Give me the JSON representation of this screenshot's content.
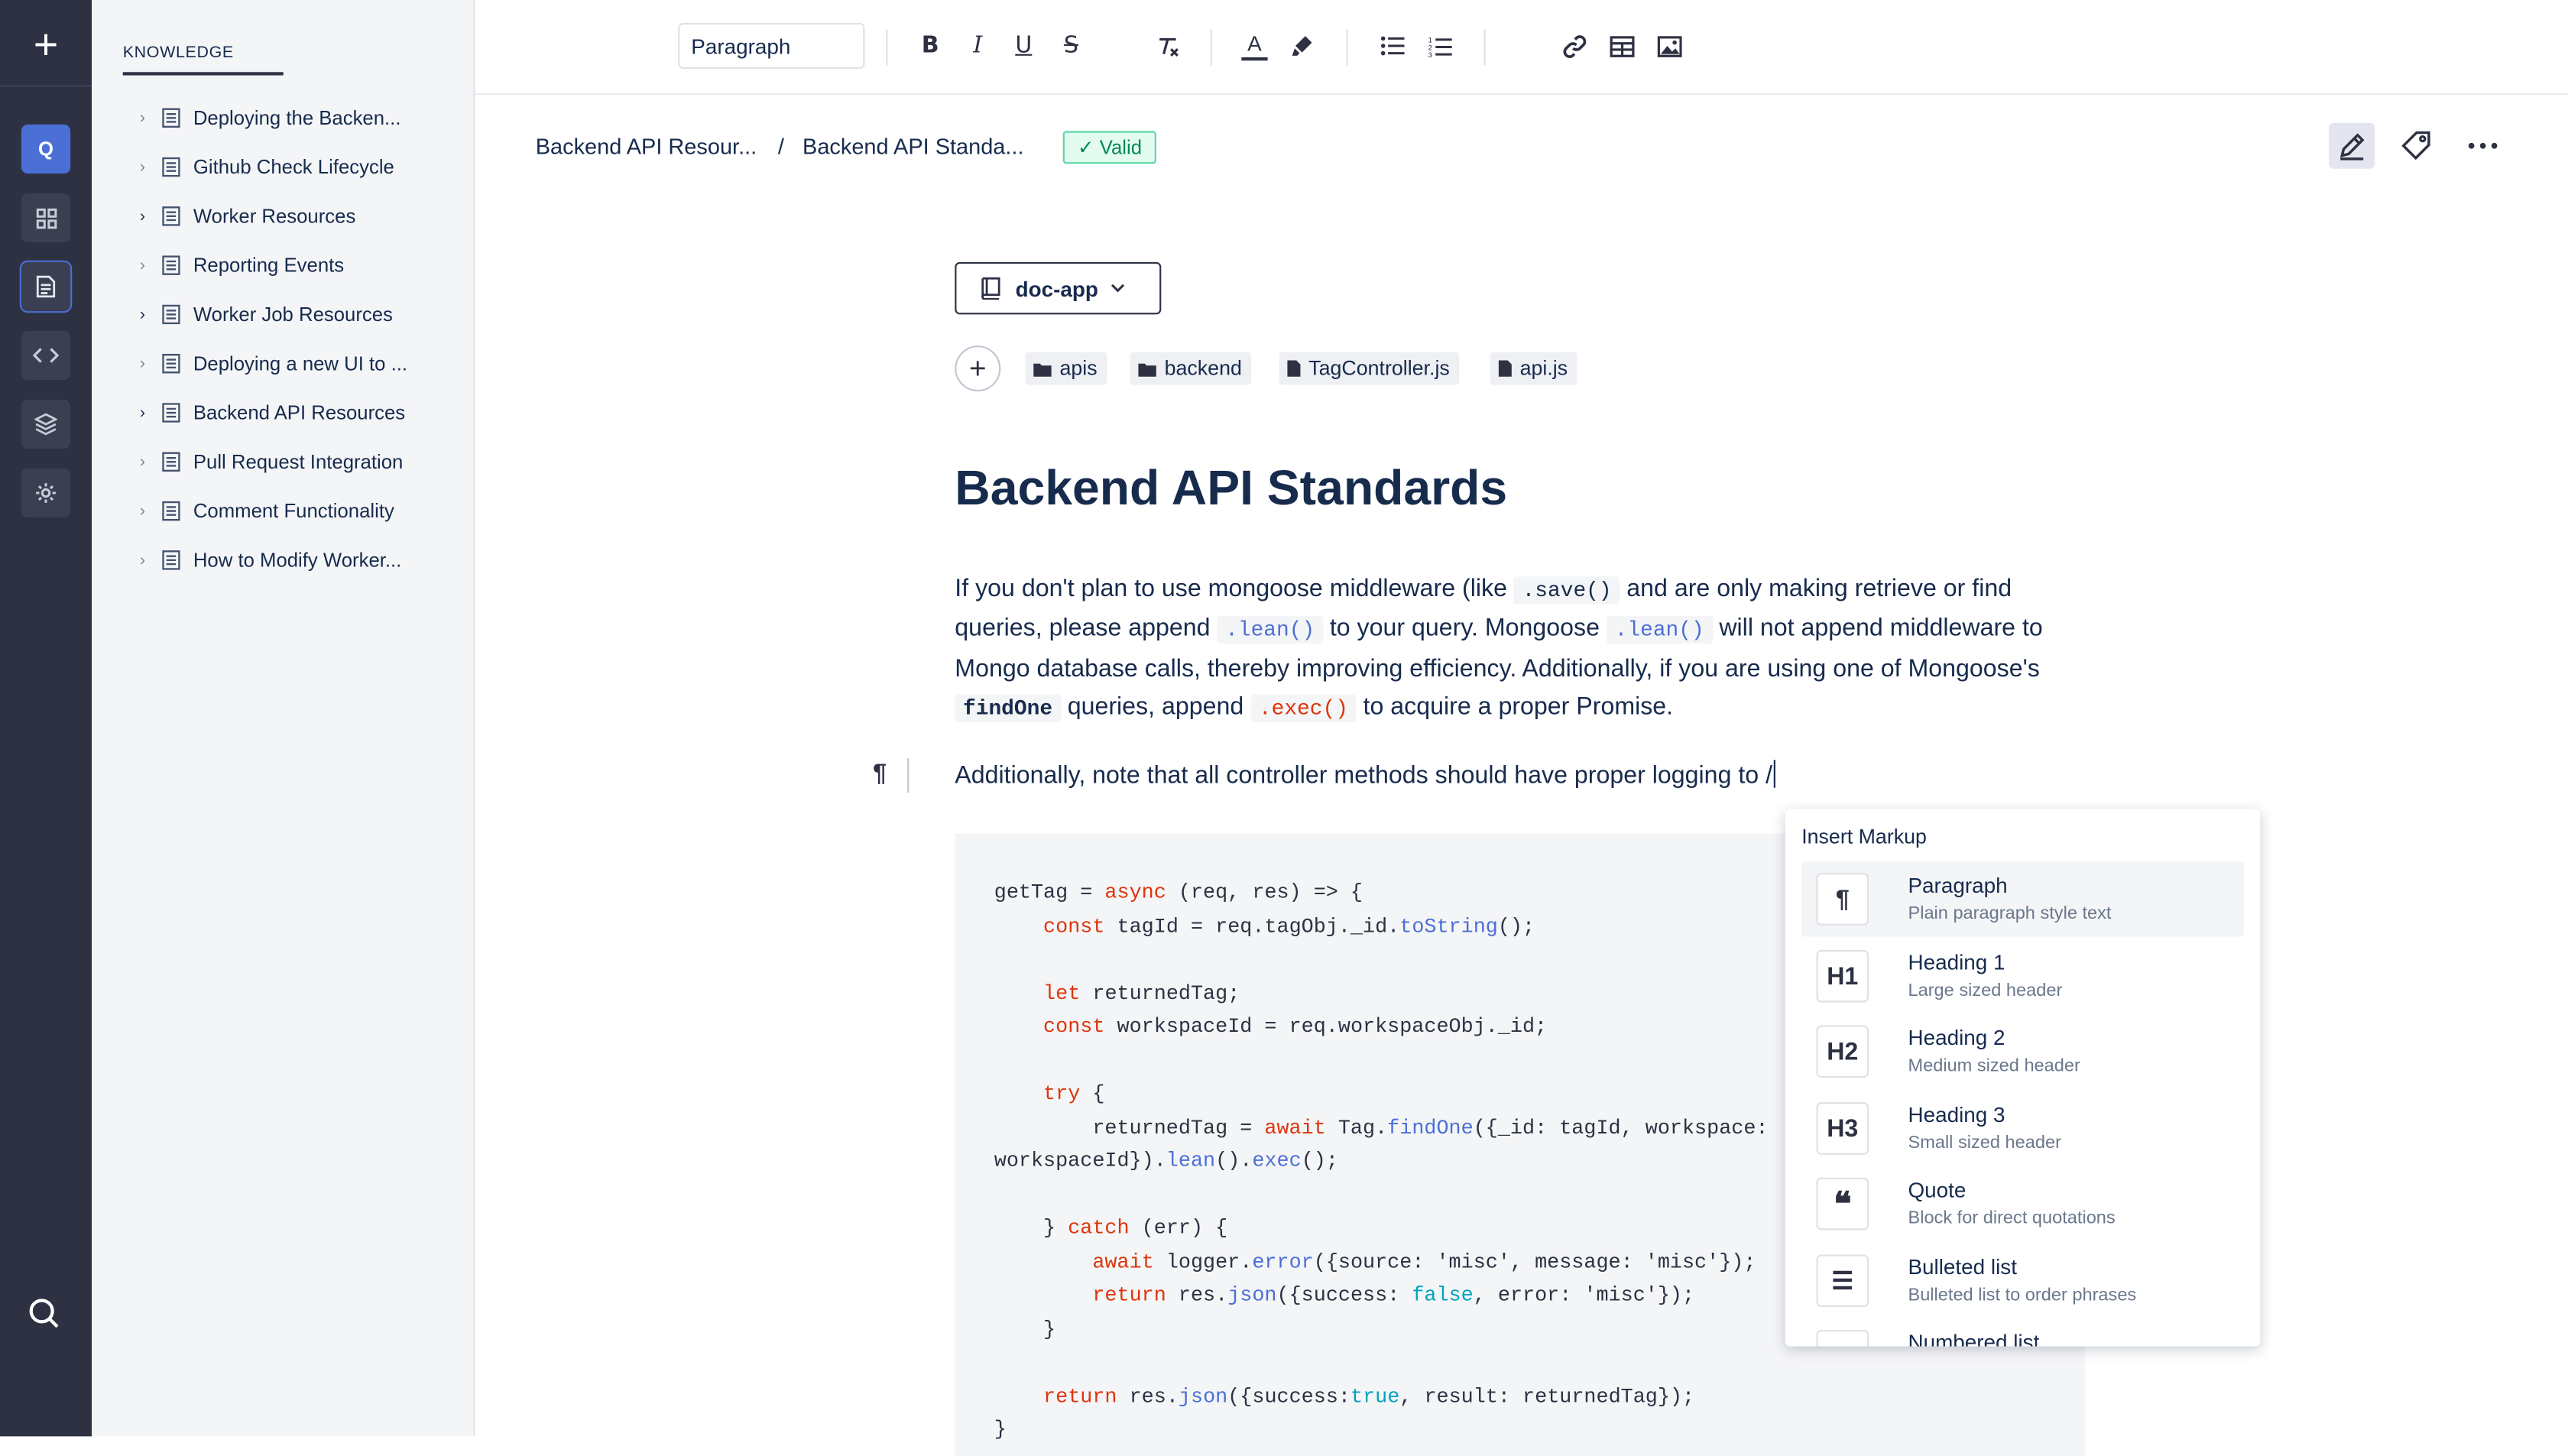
{
  "rail": {
    "new_label": "+",
    "workspace_initial": "Q"
  },
  "sidebar": {
    "heading": "KNOWLEDGE",
    "items": [
      {
        "label": "Deploying the Backen..."
      },
      {
        "label": "Github Check Lifecycle"
      },
      {
        "label": "Worker Resources"
      },
      {
        "label": "Reporting Events"
      },
      {
        "label": "Worker Job Resources"
      },
      {
        "label": "Deploying a new UI to ..."
      },
      {
        "label": "Backend API Resources"
      },
      {
        "label": "Pull Request Integration"
      },
      {
        "label": "Comment Functionality"
      },
      {
        "label": "How to Modify Worker..."
      }
    ]
  },
  "toolbar": {
    "block_type": "Paragraph",
    "font_color_letter": "A"
  },
  "header": {
    "crumb_parent": "Backend API Resour...",
    "crumb_sep": "/",
    "crumb_current": "Backend API Standa...",
    "status": "✓ Valid"
  },
  "doc": {
    "repo": "doc-app",
    "add_label": "+",
    "chips": [
      {
        "label": "apis"
      },
      {
        "label": "backend"
      },
      {
        "label": "TagController.js"
      },
      {
        "label": "api.js"
      }
    ],
    "title": "Backend API Standards",
    "p1": {
      "t1": "If you don't plan to use mongoose middleware (like ",
      "c1": ".save()",
      "t2": " and are only making retrieve or find queries, please append ",
      "c2": ".lean()",
      "t3": " to your query. Mongoose ",
      "c3": ".lean()",
      "t4": " will not append middleware to Mongo database calls, thereby improving efficiency. Additionally, if you are using one of Mongoose's ",
      "c4": "findOne",
      "t5": " queries, append ",
      "c5": ".exec()",
      "t6": " to acquire a proper Promise."
    },
    "p2": "Additionally, note that all controller methods should have proper logging to /",
    "pilcrow": "¶"
  },
  "popup": {
    "title": "Insert Markup",
    "options": [
      {
        "icon": "¶",
        "label": "Paragraph",
        "desc": "Plain paragraph style text"
      },
      {
        "icon": "H1",
        "label": "Heading 1",
        "desc": "Large sized header"
      },
      {
        "icon": "H2",
        "label": "Heading 2",
        "desc": "Medium sized header"
      },
      {
        "icon": "H3",
        "label": "Heading 3",
        "desc": "Small sized header"
      },
      {
        "icon": "❝",
        "label": "Quote",
        "desc": "Block for direct quotations"
      },
      {
        "icon": "☰",
        "label": "Bulleted list",
        "desc": "Bulleted list to order phrases"
      },
      {
        "icon": "",
        "label": "Numbered list",
        "desc": ""
      }
    ]
  },
  "code_lines": [
    "getTag = async (req, res) => {",
    "    const tagId = req.tagObj._id.toString();",
    "",
    "    let returnedTag;",
    "    const workspaceId = req.workspaceObj._id;",
    "",
    "    try {",
    "        returnedTag = await Tag.findOne({_id: tagId, workspace:",
    "workspaceId}).lean().exec();",
    "",
    "    } catch (err) {",
    "        await logger.error({source: 'misc', message: 'misc'});",
    "        return res.json({success: false, error: 'misc'});",
    "    }",
    "",
    "    return res.json({success:true, result: returnedTag});",
    "}"
  ]
}
